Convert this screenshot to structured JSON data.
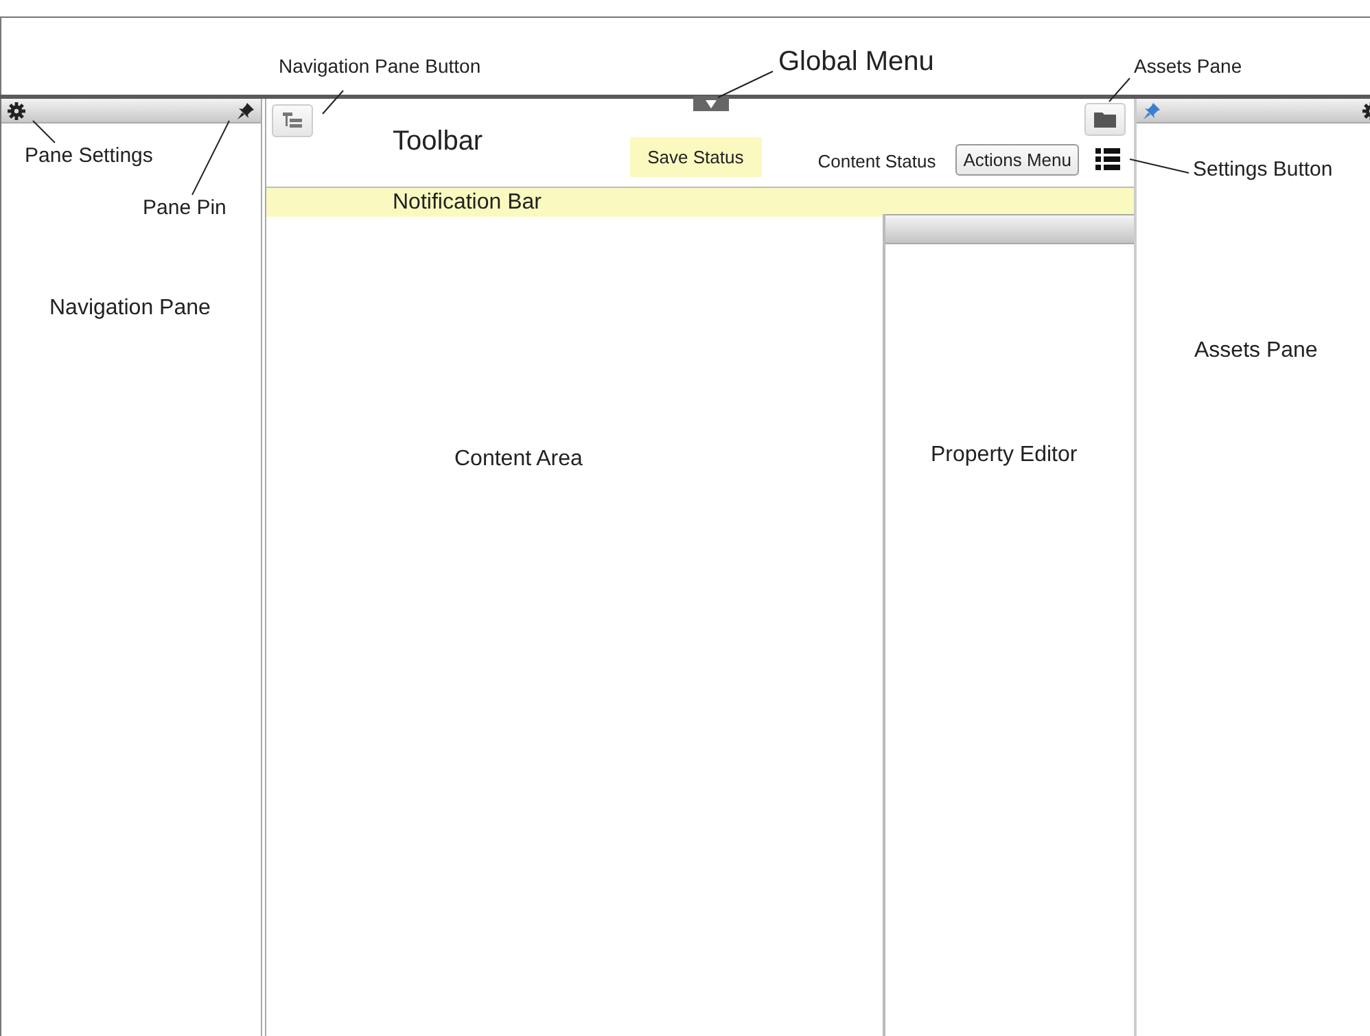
{
  "navigation_pane": {
    "label": "Navigation Pane"
  },
  "toolbar": {
    "title": "Toolbar",
    "save_status": "Save Status",
    "content_status": "Content Status",
    "actions_button": "Actions Menu"
  },
  "notification_bar": {
    "text": "Notification Bar"
  },
  "content_area": {
    "label": "Content Area"
  },
  "property_editor": {
    "label": "Property Editor"
  },
  "assets_pane": {
    "label": "Assets Pane"
  },
  "annotations": [
    {
      "kind": "navigation-pane-button",
      "text": "Navigation Pane Button"
    },
    {
      "kind": "global-menu",
      "text": "Global Menu"
    },
    {
      "kind": "assets-pane",
      "text": "Assets Pane"
    },
    {
      "kind": "settings-button",
      "text": "Settings Button"
    },
    {
      "kind": "pane-settings",
      "text": "Pane Settings"
    },
    {
      "kind": "pane-pin",
      "text": "Pane Pin"
    }
  ]
}
